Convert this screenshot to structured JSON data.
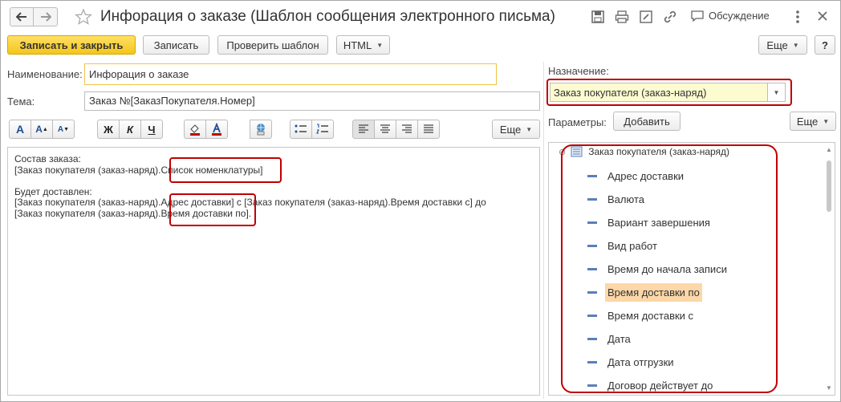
{
  "window": {
    "title": "Инфорация о заказе (Шаблон сообщения электронного письма)",
    "discussion_label": "Обсуждение"
  },
  "toolbar": {
    "save_close_label": "Записать и закрыть",
    "save_label": "Записать",
    "check_label": "Проверить шаблон",
    "format_label": "HTML",
    "more_label": "Еще",
    "help_label": "?"
  },
  "form": {
    "name_label": "Наименование:",
    "name_value": "Инфорация о заказе",
    "subject_label": "Тема:",
    "subject_value": "Заказ №[ЗаказПокупателя.Номер]"
  },
  "format_toolbar": {
    "font_big": "A",
    "font_up": "A",
    "font_down": "A",
    "bold": "Ж",
    "italic": "К",
    "underline": "Ч",
    "more_label": "Еще"
  },
  "editor": {
    "lines": [
      "Состав заказа:",
      "[Заказ покупателя (заказ-наряд).Список номенклатуры]",
      "",
      "Будет доставлен:",
      "[Заказ покупателя (заказ-наряд).Адрес доставки] с [Заказ покупателя (заказ-наряд).Время доставки с] до",
      "[Заказ покупателя (заказ-наряд).Время доставки по]."
    ]
  },
  "right_panel": {
    "purpose_label": "Назначение:",
    "purpose_value": "Заказ покупателя (заказ-наряд)",
    "params_label": "Параметры:",
    "add_button": "Добавить",
    "more_label": "Еще",
    "tree_root": "Заказ покупателя (заказ-наряд)",
    "tree_items": [
      "Адрес доставки",
      "Валюта",
      "Вариант завершения",
      "Вид работ",
      "Время до начала записи",
      "Время доставки по",
      "Время доставки с",
      "Дата",
      "Дата отгрузки",
      "Договор действует до"
    ],
    "selected_item": "Время доставки по"
  },
  "colors": {
    "accent_yellow": "#f5c518",
    "highlight_red": "#c00000",
    "selection_orange": "#fcd7a8",
    "select_bg": "#fdfbd0"
  }
}
